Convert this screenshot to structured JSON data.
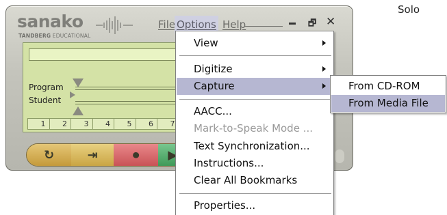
{
  "corner_label": "Solo",
  "app": {
    "logo_main": "sanako",
    "logo_sub_bold": "TANDBERG",
    "logo_sub_rest": " EDUCATIONAL"
  },
  "menubar": {
    "file": "File",
    "options": "Options",
    "help": "Help"
  },
  "window_controls": {
    "restore_glyph": "🗗",
    "close_glyph": "✕"
  },
  "panel": {
    "program_label": "Program",
    "student_label": "Student",
    "ticks": [
      "1",
      "2",
      "3",
      "4",
      "5",
      "6",
      "7"
    ]
  },
  "transport": {
    "icons": [
      "repeat-icon",
      "back-icon",
      "record-icon",
      "play-icon"
    ],
    "glyphs": [
      "↻",
      "⇥",
      "⏺",
      "▶"
    ]
  },
  "options_menu": {
    "view": "View",
    "digitize": "Digitize",
    "capture": "Capture",
    "aacc": "AACC...",
    "mark_to_speak": "Mark-to-Speak Mode ...",
    "text_sync": "Text Synchronization...",
    "instructions": "Instructions...",
    "clear_bookmarks": "Clear All Bookmarks",
    "properties": "Properties..."
  },
  "capture_submenu": {
    "from_cd": "From CD-ROM",
    "from_media": "From Media File"
  },
  "colors": {
    "menu_highlight": "#b6b7d2",
    "panel_green": "#d4e2a6"
  }
}
